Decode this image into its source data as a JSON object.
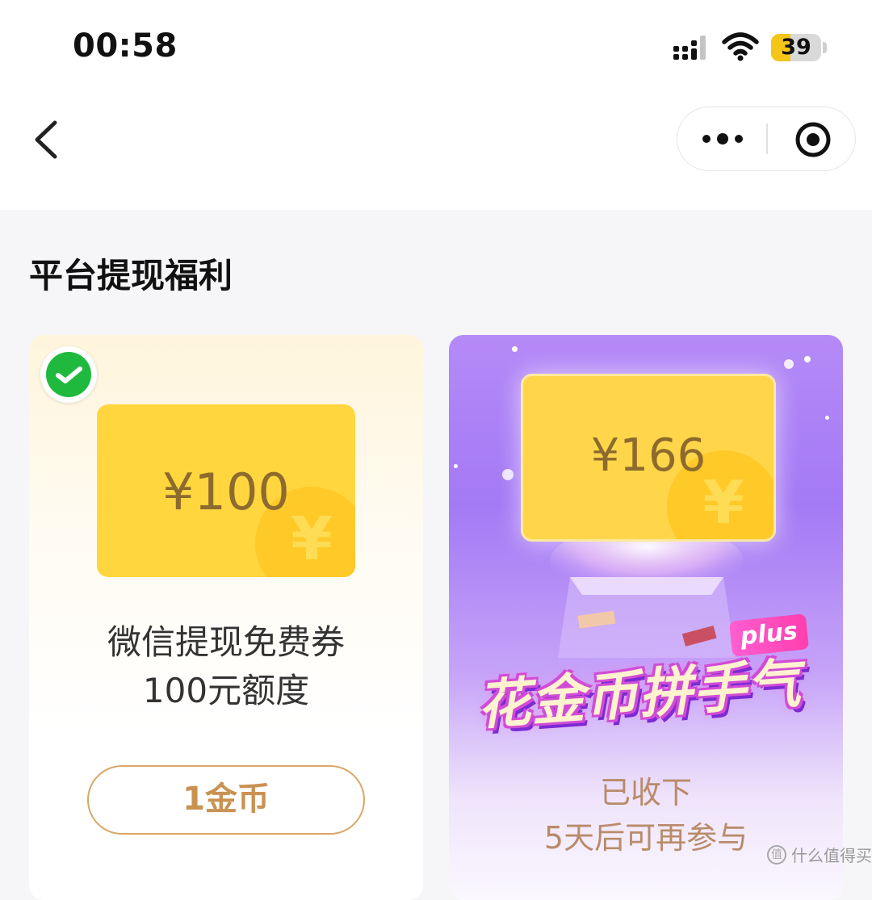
{
  "status_bar": {
    "time": "00:58",
    "battery_level": "39",
    "battery_fraction": 0.39,
    "icons": [
      "signal-icon",
      "wifi-icon",
      "battery-icon"
    ]
  },
  "nav": {
    "back_icon": "chevron-left-icon",
    "more_icon": "more-dots-icon",
    "close_icon": "target-circle-icon"
  },
  "section": {
    "title": "平台提现福利"
  },
  "cards": [
    {
      "badge_icon": "wechat-icon",
      "amount": "¥100",
      "coin_symbol": "¥",
      "title_line1": "微信提现免费券",
      "title_line2": "100元额度",
      "button_label": "1金币"
    },
    {
      "amount": "¥166",
      "coin_symbol": "¥",
      "banner_text": "花金币拼手气",
      "banner_tag": "plus",
      "status_line1": "已收下",
      "status_line2": "5天后可再参与"
    }
  ],
  "watermark": {
    "text": "什么值得买",
    "icon_glyph": "值"
  },
  "colors": {
    "coupon_yellow": "#ffd63d",
    "amount_brown": "#8d6a2e",
    "button_gold": "#c99252",
    "card_purple": "#a479f5"
  }
}
